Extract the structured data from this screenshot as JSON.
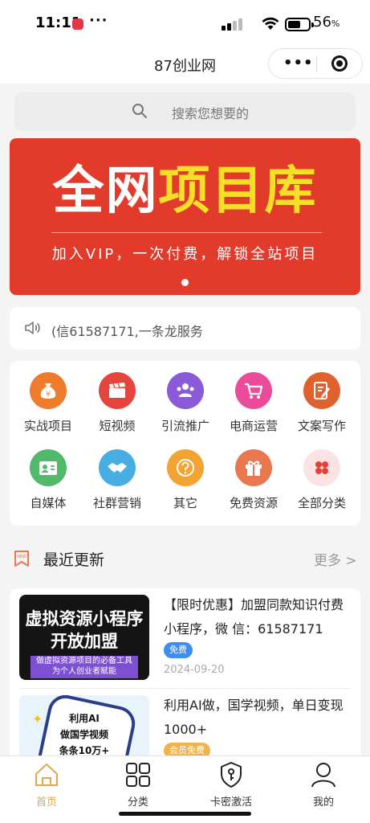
{
  "status": {
    "time": "11:11",
    "app_badge": "··· ",
    "battery": "56",
    "battery_unit": "%"
  },
  "header": {
    "title": "87创业网",
    "more_label": "•••"
  },
  "search": {
    "placeholder": "搜索您想要的"
  },
  "banner": {
    "title_white": "全网",
    "title_yellow": "项目库",
    "subtitle": "加入VIP，一次付费，解锁全站项目"
  },
  "notice": {
    "text": "(信61587171,一条龙服务"
  },
  "categories": [
    {
      "label": "实战项目",
      "icon": "money-bag-icon",
      "color": "#ef7b2d"
    },
    {
      "label": "短视频",
      "icon": "clapperboard-icon",
      "color": "#e6453e"
    },
    {
      "label": "引流推广",
      "icon": "people-icon",
      "color": "#8a5ad8"
    },
    {
      "label": "电商运营",
      "icon": "cart-icon",
      "color": "#ec4b9b"
    },
    {
      "label": "文案写作",
      "icon": "edit-icon",
      "color": "#e0612d"
    },
    {
      "label": "自媒体",
      "icon": "id-card-icon",
      "color": "#52b86a"
    },
    {
      "label": "社群营销",
      "icon": "handshake-icon",
      "color": "#46aee0"
    },
    {
      "label": "其它",
      "icon": "question-icon",
      "color": "#f2a332"
    },
    {
      "label": "免费资源",
      "icon": "gift-icon",
      "color": "#e9774f"
    },
    {
      "label": "全部分类",
      "icon": "grid-icon",
      "color": "#fbe3e3"
    }
  ],
  "recent": {
    "title": "最近更新",
    "more": "更多 >"
  },
  "items": [
    {
      "title": "【限时优惠】加盟同款知识付费小程序，微 信：61587171",
      "badge": "免费",
      "date": "2024-09-20",
      "thumb_line1": "虚拟资源小程序",
      "thumb_line2": "开放加盟",
      "thumb_band1": "做虚拟资源项目的必备工具",
      "thumb_band2": "为个人创业者赋能"
    },
    {
      "title": "利用AI做，国学视频，单日变现1000+",
      "badge": "会员免费",
      "thumb_line1": "利用AI",
      "thumb_line2": "做国学视频",
      "thumb_line3": "条条10万+"
    }
  ],
  "tabs": [
    {
      "label": "首页",
      "icon": "home-icon",
      "active": true
    },
    {
      "label": "分类",
      "icon": "grid-icon",
      "active": false
    },
    {
      "label": "卡密激活",
      "icon": "shield-key-icon",
      "active": false
    },
    {
      "label": "我的",
      "icon": "user-icon",
      "active": false
    }
  ],
  "colors": {
    "accent": "#e0a652",
    "banner": "#e23b2c",
    "banner_yellow": "#f5e027"
  }
}
